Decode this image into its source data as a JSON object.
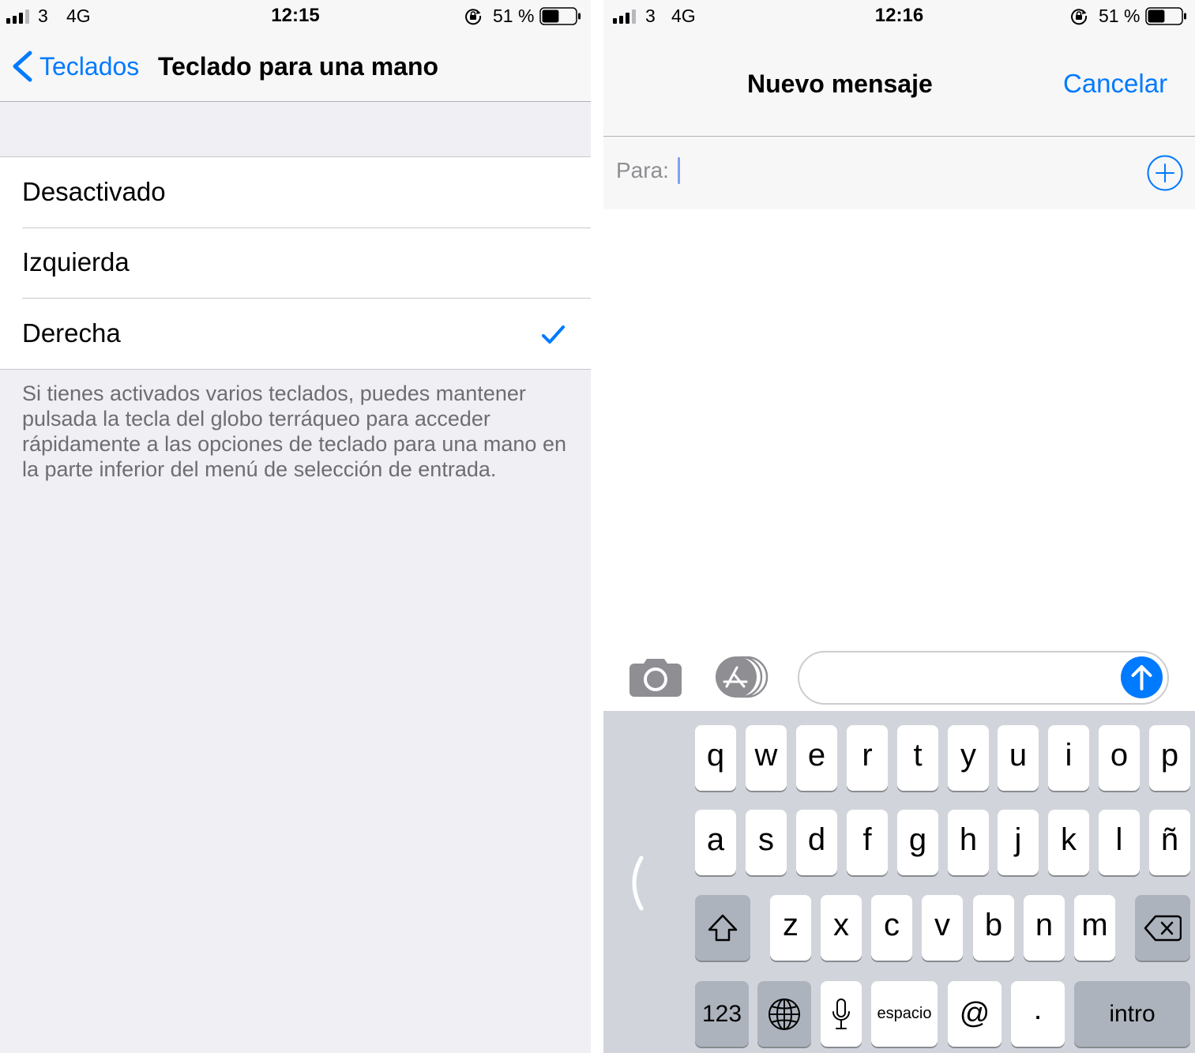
{
  "colors": {
    "accent": "#007aff",
    "group_background": "#efeff4",
    "bar_background": "#f7f7f7",
    "separator": "#c8c7cc",
    "footer_text": "#6d6d72",
    "keyboard_background": "#d1d5db",
    "dark_key": "#acb3bd",
    "icon_gray": "#8e8e93"
  },
  "icons": {
    "back": "chevron-left-icon",
    "selected": "checkmark-icon",
    "add_contact": "plus-circle-icon",
    "camera": "camera-icon",
    "apps": "app-store-icon",
    "send": "arrow-up-icon"
  },
  "left": {
    "status_bar": {
      "carrier": "3",
      "network": "4G",
      "time": "12:15",
      "battery_text": "51 %",
      "battery_level": 0.51
    },
    "nav": {
      "back_label": "Teclados",
      "title": "Teclado para una mano"
    },
    "options": [
      {
        "label": "Desactivado",
        "selected": false
      },
      {
        "label": "Izquierda",
        "selected": false
      },
      {
        "label": "Derecha",
        "selected": true
      }
    ],
    "footer_lines": [
      "Si tienes activados varios teclados, puedes mantener",
      "pulsada la tecla del globo terráqueo para acceder",
      "rápidamente a las opciones de teclado para una mano en",
      "la parte inferior del menú de selección de entrada."
    ]
  },
  "right": {
    "status_bar": {
      "carrier": "3",
      "network": "4G",
      "time": "12:16",
      "battery_text": "51 %",
      "battery_level": 0.51
    },
    "header": {
      "title": "Nuevo mensaje",
      "cancel_label": "Cancelar"
    },
    "to_field": {
      "label": "Para:"
    },
    "keyboard": {
      "row1": [
        "q",
        "w",
        "e",
        "r",
        "t",
        "y",
        "u",
        "i",
        "o",
        "p"
      ],
      "row2": [
        "a",
        "s",
        "d",
        "f",
        "g",
        "h",
        "j",
        "k",
        "l",
        "ñ"
      ],
      "row3": [
        "z",
        "x",
        "c",
        "v",
        "b",
        "n",
        "m"
      ],
      "numbers_label": "123",
      "space_label": "espacio",
      "at_label": "@",
      "period_label": ".",
      "return_label": "intro"
    }
  }
}
